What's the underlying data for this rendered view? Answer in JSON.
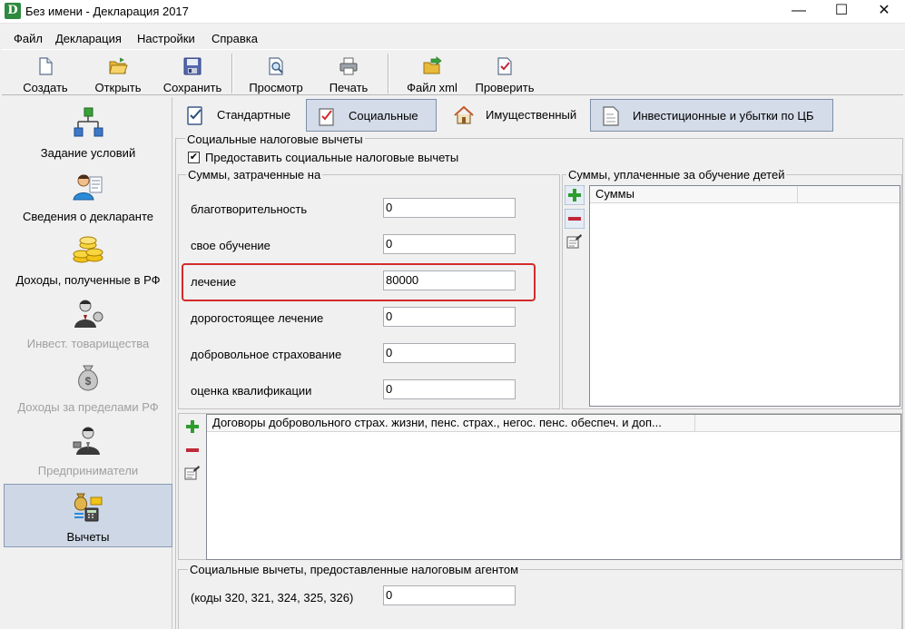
{
  "window": {
    "title": "Без имени - Декларация 2017",
    "app_icon_letter": "D",
    "controls": {
      "minimize": "—",
      "maximize": "☐",
      "close": "✕"
    }
  },
  "menu": [
    "Файл",
    "Декларация",
    "Настройки",
    "Справка"
  ],
  "toolbar": {
    "create": "Создать",
    "open": "Открыть",
    "save": "Сохранить",
    "preview": "Просмотр",
    "print": "Печать",
    "xml": "Файл xml",
    "check": "Проверить"
  },
  "sidebar": {
    "items": [
      {
        "label": "Задание условий",
        "icon": "conditions-icon",
        "enabled": true
      },
      {
        "label": "Сведения о декларанте",
        "icon": "declarant-icon",
        "enabled": true
      },
      {
        "label": "Доходы, полученные в РФ",
        "icon": "coins-icon",
        "enabled": true
      },
      {
        "label": "Инвест. товарищества",
        "icon": "investor-icon",
        "enabled": false
      },
      {
        "label": "Доходы за пределами РФ",
        "icon": "money-bag-icon",
        "enabled": false
      },
      {
        "label": "Предприниматели",
        "icon": "businessman-icon",
        "enabled": false
      },
      {
        "label": "Вычеты",
        "icon": "deductions-icon",
        "enabled": true,
        "active": true
      }
    ]
  },
  "tabs": [
    {
      "label": "Стандартные",
      "selected": false
    },
    {
      "label": "Социальные",
      "selected": true
    },
    {
      "label": "Имущественный",
      "selected": false
    },
    {
      "label": "Инвестиционные и убытки по ЦБ",
      "selected": false
    }
  ],
  "social": {
    "group_title": "Социальные налоговые вычеты",
    "provide_checkbox_label": "Предоставить социальные налоговые вычеты",
    "provide_checked": true,
    "check_mark": "✔",
    "amounts_title": "Суммы, затраченные на",
    "rows": [
      {
        "label": "благотворительность",
        "value": "0"
      },
      {
        "label": "свое обучение",
        "value": "0"
      },
      {
        "label": "лечение",
        "value": "80000"
      },
      {
        "label": "дорогостоящее лечение",
        "value": "0"
      },
      {
        "label": "добровольное страхование",
        "value": "0"
      },
      {
        "label": "оценка квалификации",
        "value": "0"
      }
    ],
    "children_title": "Суммы, уплаченные за обучение детей",
    "children_column": "Суммы",
    "contracts_column": "Договоры добровольного страх. жизни, пенс. страх., негос. пенс. обеспеч. и доп...",
    "agent_title": "Социальные вычеты, предоставленные налоговым агентом",
    "agent_label": "(коды 320, 321, 324, 325, 326)",
    "agent_value": "0"
  },
  "colors": {
    "highlight": "#d42a2a",
    "active_bg": "#cdd7e6",
    "add_green": "#2e9d2e",
    "remove_red": "#c0283a"
  }
}
